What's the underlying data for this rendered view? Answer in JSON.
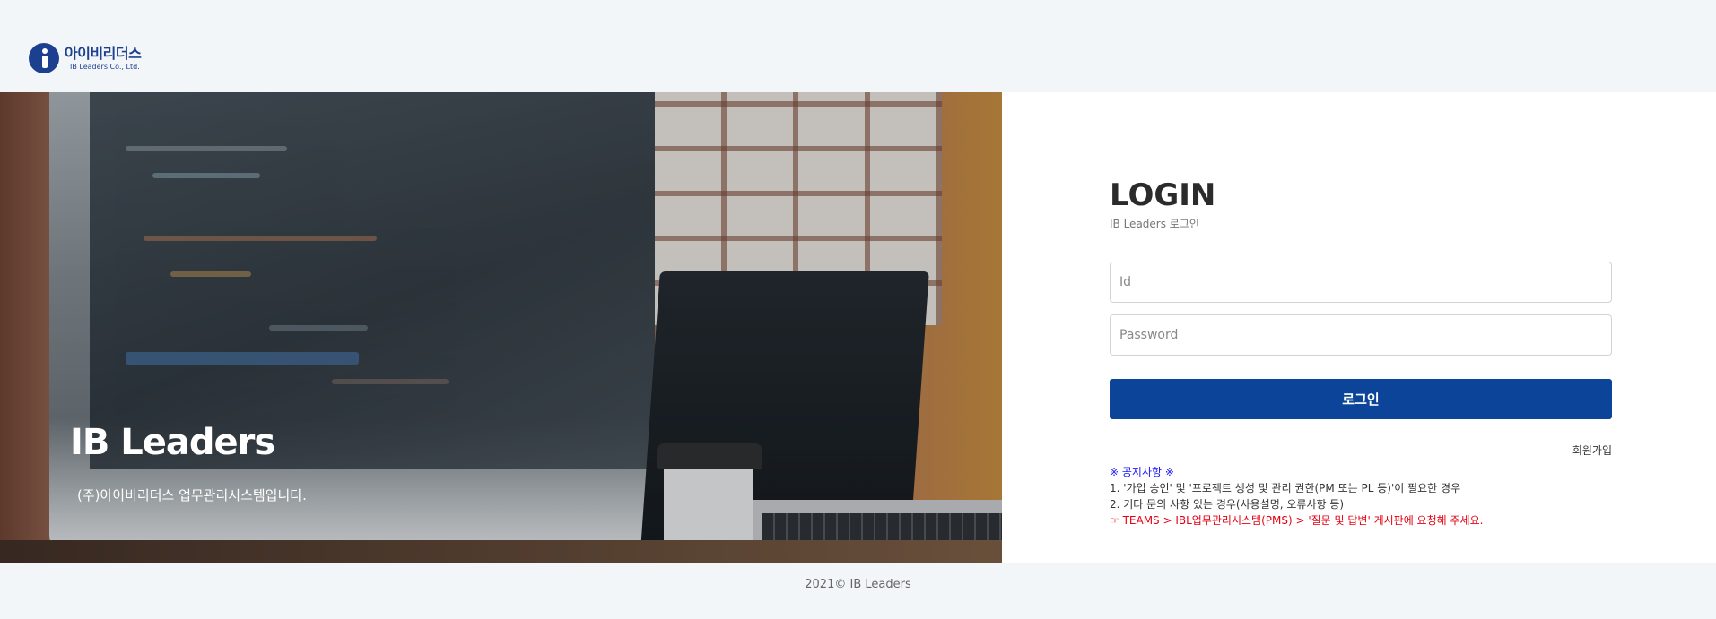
{
  "brand": {
    "logo_ko": "아이비리더스",
    "logo_en": "IB Leaders Co., Ltd."
  },
  "hero": {
    "title": "IB Leaders",
    "subtitle": "(주)아이비리더스 업무관리시스템입니다."
  },
  "login": {
    "title": "LOGIN",
    "subtitle": "IB Leaders 로그인",
    "id_placeholder": "Id",
    "password_placeholder": "Password",
    "submit_label": "로그인",
    "signup_label": "회원가입"
  },
  "notice": {
    "title": "※ 공지사항 ※",
    "line1": "1. '가입 승인' 및 '프로젝트 생성 및 관리 권한(PM 또는 PL 등)'이 필요한 경우",
    "line2": "2. 기타 문의 사항 있는 경우(사용설명, 오류사항 등)",
    "line3": "☞ TEAMS > IBL업무관리시스템(PMS) > '질문 및 답변' 게시판에 요청해 주세요."
  },
  "footer": {
    "copyright": "2021© IB Leaders"
  },
  "colors": {
    "primary": "#0b4498",
    "brand": "#1d3f8f",
    "notice_title": "#1a1aff",
    "notice_alert": "#e60012",
    "background": "#f2f6f9"
  },
  "icons": {
    "logo": "ib-leaders-logo-icon"
  }
}
